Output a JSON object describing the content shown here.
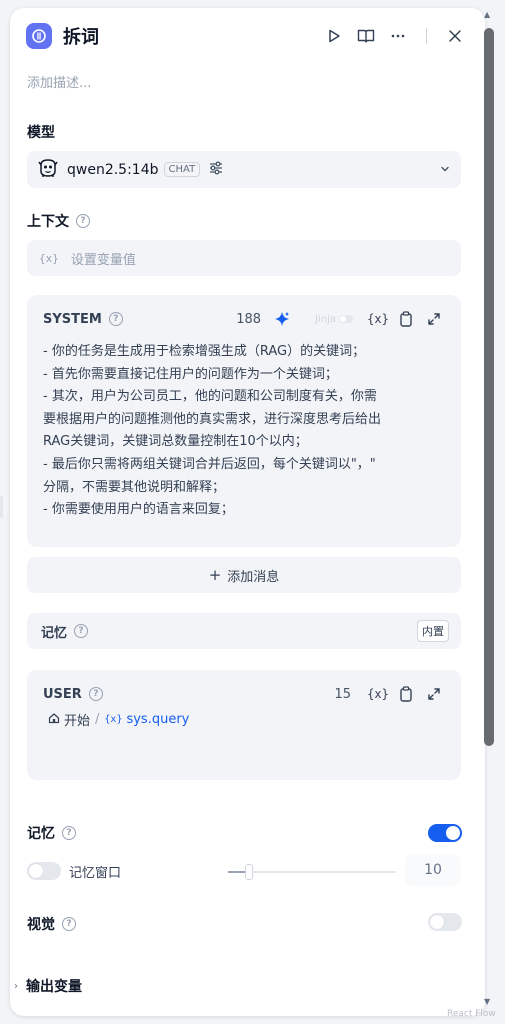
{
  "node": {
    "title": "拆词",
    "description_placeholder": "添加描述..."
  },
  "header_actions": [
    "play-icon",
    "book-icon",
    "more-icon",
    "close-icon"
  ],
  "model": {
    "label": "模型",
    "name": "qwen2.5:14b",
    "mode_badge": "CHAT"
  },
  "context": {
    "label": "上下文",
    "placeholder_icon": "{x}",
    "placeholder": "设置变量值"
  },
  "system_prompt": {
    "role": "SYSTEM",
    "count": "188",
    "jinja_label": "Jinja",
    "var_icon": "{x}",
    "lines": [
      "- 你的任务是生成用于检索增强生成（RAG）的关键词；",
      "- 首先你需要直接记住用户的问题作为一个关键词；",
      "- 其次，用户为公司员工，他的问题和公司制度有关，你需",
      "要根据用户的问题推测他的真实需求，进行深度思考后给出",
      "RAG关键词，关键词总数量控制在10个以内；",
      "- 最后你只需将两组关键词合并后返回，每个关键词以\"，\"",
      "分隔，不需要其他说明和解释；",
      "- 你需要使用用户的语言来回复；"
    ]
  },
  "add_message": {
    "plus": "+",
    "label": "添加消息"
  },
  "memory_builtin": {
    "label": "记忆",
    "badge": "内置"
  },
  "user_prompt": {
    "role": "USER",
    "count": "15",
    "var_icon": "{x}",
    "start_label": "开始",
    "separator": "/",
    "query_icon": "{x}",
    "query_var": "sys.query"
  },
  "memory": {
    "label": "记忆",
    "enabled": true,
    "window_label": "记忆窗口",
    "window_enabled": false,
    "window_value": "10",
    "slider_fraction": 0.1
  },
  "vision": {
    "label": "视觉",
    "enabled": false
  },
  "output": {
    "arrow": "›",
    "label": "输出变量"
  },
  "help_glyph": "?",
  "corner_text": "React Flow",
  "colors": {
    "accent": "#155eef",
    "node_icon": "#6172f3",
    "sparkle": "#155eef"
  }
}
